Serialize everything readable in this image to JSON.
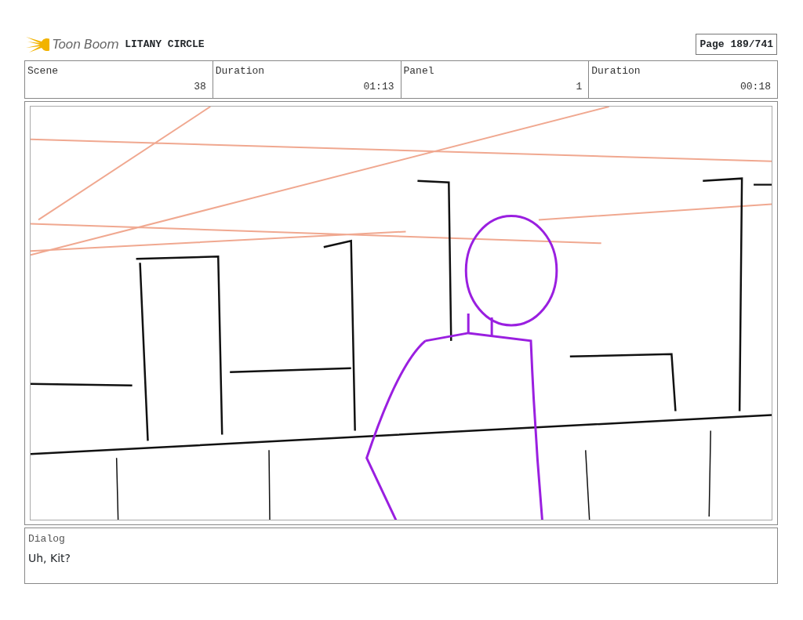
{
  "header": {
    "logo_text": "Toon Boom",
    "project_title": "LITANY CIRCLE",
    "page": "Page 189/741"
  },
  "fields": [
    {
      "label": "Scene",
      "value": "38"
    },
    {
      "label": "Duration",
      "value": "01:13"
    },
    {
      "label": "Panel",
      "value": "1"
    },
    {
      "label": "Duration",
      "value": "00:18"
    }
  ],
  "dialog": {
    "label": "Dialog",
    "text": "Uh, Kit?"
  }
}
